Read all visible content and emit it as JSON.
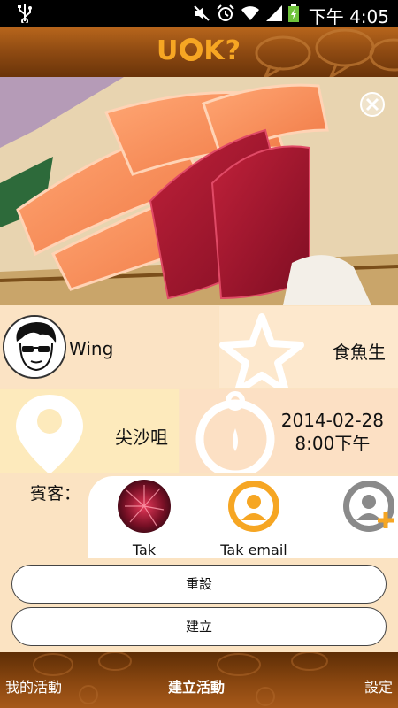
{
  "status_bar": {
    "time": "下午 4:05"
  },
  "header": {
    "logo_left": "U",
    "logo_right": "K?"
  },
  "event": {
    "host_name": "Wing",
    "title": "食魚生",
    "location": "尖沙咀",
    "date": "2014-02-28",
    "time": "8:00下午"
  },
  "guests": {
    "label": "賓客：",
    "items": [
      {
        "name": "Tak"
      },
      {
        "name": "Tak email"
      }
    ]
  },
  "buttons": {
    "reset": "重設",
    "create": "建立"
  },
  "nav": {
    "my_events": "我的活動",
    "create_event": "建立活動",
    "settings": "設定"
  },
  "colors": {
    "accent": "#f6a623",
    "header_brown": "#8e4a12",
    "tile_bg": "#fbe3c4"
  }
}
